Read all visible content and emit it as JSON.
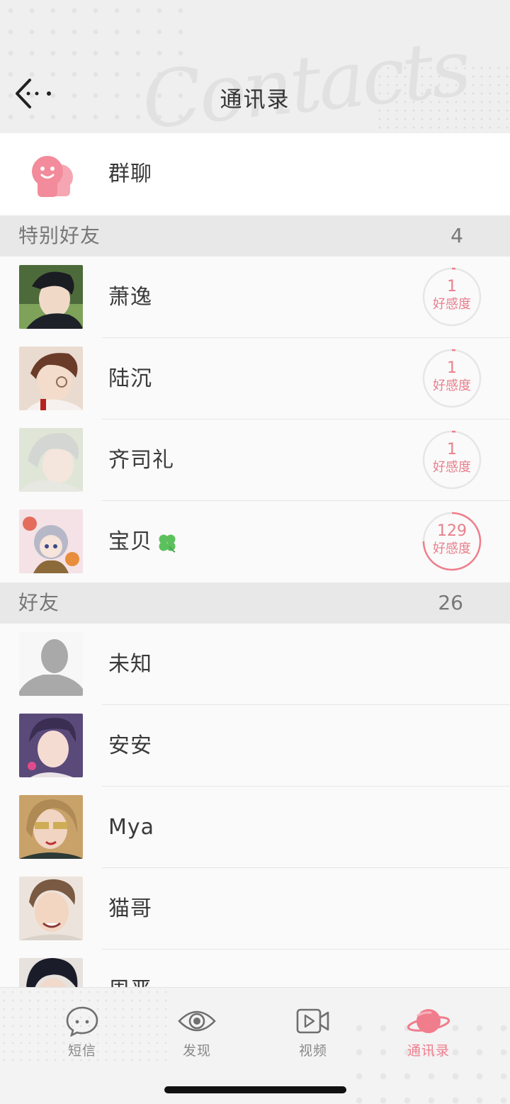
{
  "header": {
    "title": "通讯录",
    "watermark": "Contacts",
    "back_icon": "back-arrow-icon"
  },
  "group_chat": {
    "label": "群聊",
    "icon": "group-chat-icon"
  },
  "special_friends": {
    "title": "特别好友",
    "count": "4",
    "items": [
      {
        "name": "萧逸",
        "affinity": "1",
        "affinity_label": "好感度",
        "progress": 0.02
      },
      {
        "name": "陆沉",
        "affinity": "1",
        "affinity_label": "好感度",
        "progress": 0.02
      },
      {
        "name": "齐司礼",
        "affinity": "1",
        "affinity_label": "好感度",
        "progress": 0.02
      },
      {
        "name": "宝贝",
        "badge": "clover-icon",
        "affinity": "129",
        "affinity_label": "好感度",
        "progress": 0.75
      }
    ]
  },
  "friends": {
    "title": "好友",
    "count": "26",
    "items": [
      {
        "name": "未知"
      },
      {
        "name": "安安"
      },
      {
        "name": "Mya"
      },
      {
        "name": "猫哥"
      },
      {
        "name": "周严"
      }
    ]
  },
  "tabbar": {
    "items": [
      {
        "label": "短信",
        "icon": "message-bubble-icon",
        "active": false
      },
      {
        "label": "发现",
        "icon": "eye-icon",
        "active": false
      },
      {
        "label": "视频",
        "icon": "video-camera-icon",
        "active": false
      },
      {
        "label": "通讯录",
        "icon": "planet-icon",
        "active": true
      }
    ]
  },
  "colors": {
    "accent": "#f07d8c",
    "ring_track": "#e6e6e6"
  }
}
